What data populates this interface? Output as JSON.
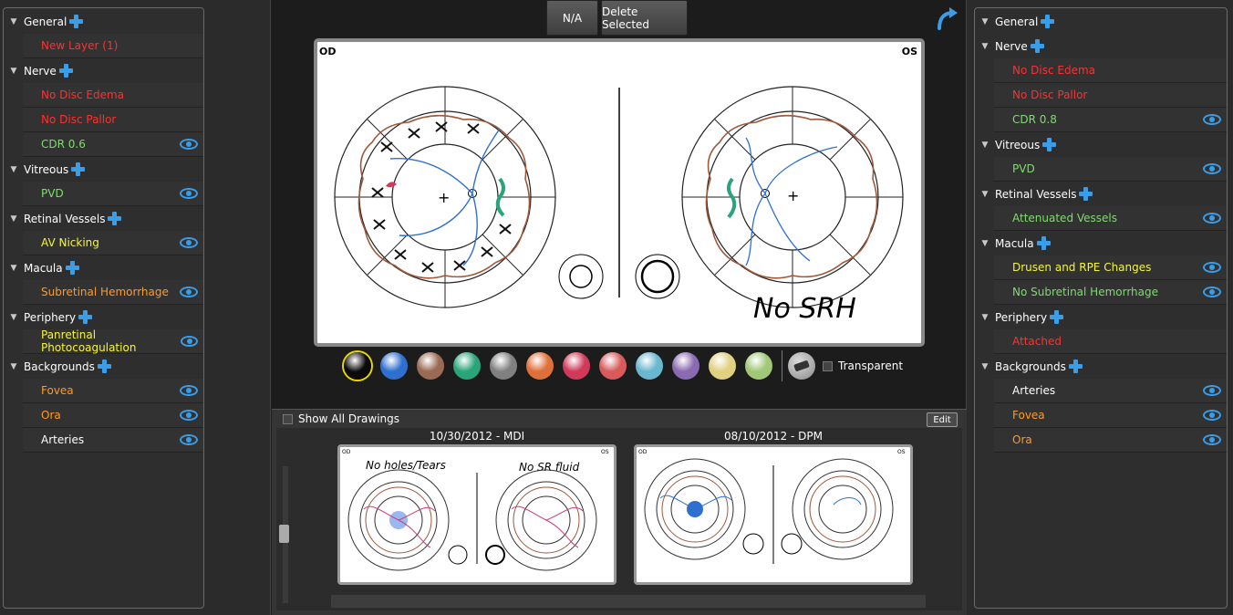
{
  "toolbar": {
    "na_label": "N/A",
    "delete_label": "Delete Selected"
  },
  "canvas": {
    "od_label": "OD",
    "os_label": "OS",
    "os_note": "No SRH"
  },
  "palette": {
    "colors": [
      "#0b0b0b",
      "#2f6fd0",
      "#9a6a55",
      "#2aa57a",
      "#808080",
      "#e0703a",
      "#d03a5a",
      "#d85a5a",
      "#6ab7d0",
      "#8a6ab0",
      "#e0d080",
      "#a0c878"
    ],
    "transparent_label": "Transparent"
  },
  "bottom": {
    "show_all_label": "Show All Drawings",
    "edit_label": "Edit",
    "thumbs": [
      {
        "title": "10/30/2012 - MDI",
        "note_left": "No holes/Tears",
        "note_right": "No SR fluid"
      },
      {
        "title": "08/10/2012 - DPM"
      }
    ]
  },
  "left": {
    "groups": [
      {
        "label": "General",
        "items": [
          {
            "label": "New Layer (1)",
            "color": "#ff3030",
            "eye": false
          }
        ]
      },
      {
        "label": "Nerve",
        "items": [
          {
            "label": "No Disc Edema",
            "color": "#ff3030",
            "eye": false
          },
          {
            "label": "No Disc Pallor",
            "color": "#ff3030",
            "eye": false
          },
          {
            "label": "CDR 0.6",
            "color": "#7fdc6e",
            "eye": true
          }
        ]
      },
      {
        "label": "Vitreous",
        "items": [
          {
            "label": "PVD",
            "color": "#7fdc6e",
            "eye": true
          }
        ]
      },
      {
        "label": "Retinal Vessels",
        "items": [
          {
            "label": "AV Nicking",
            "color": "#f5f53a",
            "eye": true
          }
        ]
      },
      {
        "label": "Macula",
        "items": [
          {
            "label": "Subretinal Hemorrhage",
            "color": "#ff9a28",
            "eye": true
          }
        ]
      },
      {
        "label": "Periphery",
        "items": [
          {
            "label": "Panretinal Photocoagulation",
            "color": "#f5f53a",
            "eye": true
          }
        ]
      },
      {
        "label": "Backgrounds",
        "items": [
          {
            "label": "Fovea",
            "color": "#ff9a28",
            "eye": true
          },
          {
            "label": "Ora",
            "color": "#ff9a28",
            "eye": true
          },
          {
            "label": "Arteries",
            "color": "#ffffff",
            "eye": true
          }
        ]
      }
    ]
  },
  "right": {
    "groups": [
      {
        "label": "General",
        "items": []
      },
      {
        "label": "Nerve",
        "items": [
          {
            "label": "No Disc Edema",
            "color": "#ff3030",
            "eye": false
          },
          {
            "label": "No Disc Pallor",
            "color": "#ff3030",
            "eye": false
          },
          {
            "label": "CDR 0.8",
            "color": "#7fdc6e",
            "eye": true
          }
        ]
      },
      {
        "label": "Vitreous",
        "items": [
          {
            "label": "PVD",
            "color": "#7fdc6e",
            "eye": true
          }
        ]
      },
      {
        "label": "Retinal Vessels",
        "items": [
          {
            "label": "Attenuated Vessels",
            "color": "#7fdc6e",
            "eye": true
          }
        ]
      },
      {
        "label": "Macula",
        "items": [
          {
            "label": "Drusen and RPE Changes",
            "color": "#f5f53a",
            "eye": true
          },
          {
            "label": "No Subretinal Hemorrhage",
            "color": "#7fdc6e",
            "eye": true
          }
        ]
      },
      {
        "label": "Periphery",
        "items": [
          {
            "label": "Attached",
            "color": "#ff3030",
            "eye": false
          }
        ]
      },
      {
        "label": "Backgrounds",
        "items": [
          {
            "label": "Arteries",
            "color": "#ffffff",
            "eye": true
          },
          {
            "label": "Fovea",
            "color": "#ff9a28",
            "eye": true
          },
          {
            "label": "Ora",
            "color": "#ff9a28",
            "eye": true
          }
        ]
      }
    ]
  }
}
